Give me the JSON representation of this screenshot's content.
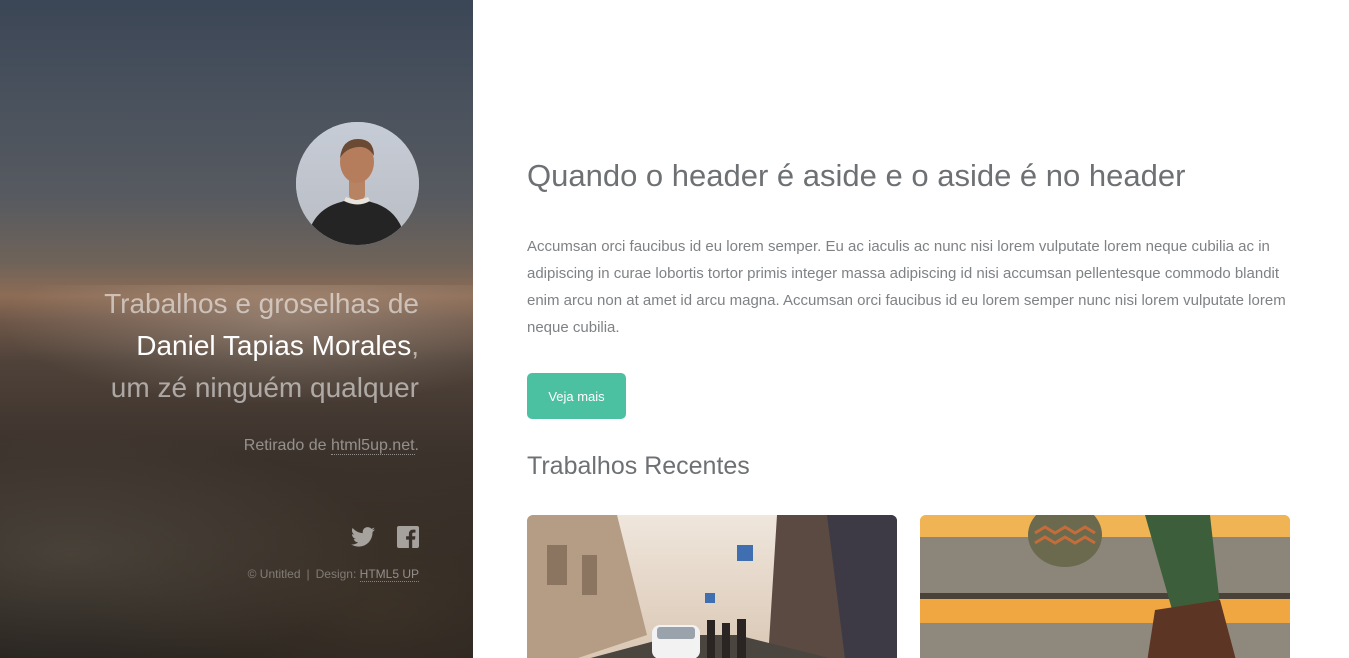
{
  "sidebar": {
    "tagline": {
      "line1": "Trabalhos e groselhas de",
      "name": "Daniel Tapias Morales",
      "comma": ",",
      "line3": "um zé ninguém qualquer"
    },
    "source": {
      "prefix": "Retirado de ",
      "link_text": "html5up.net",
      "suffix": "."
    },
    "social": [
      {
        "icon": "twitter-icon"
      },
      {
        "icon": "facebook-icon"
      }
    ],
    "copyright": {
      "text": "© Untitled",
      "separator": "|",
      "design_label": "Design: ",
      "design_link": "HTML5 UP"
    }
  },
  "main": {
    "title": "Quando o header é aside e o aside é no header",
    "intro": "Accumsan orci faucibus id eu lorem semper. Eu ac iaculis ac nunc nisi lorem vulputate lorem neque cubilia ac in adipiscing in curae lobortis tortor primis integer massa adipiscing id nisi accumsan pellentesque commodo blandit enim arcu non at amet id arcu magna. Accumsan orci faucibus id eu lorem semper nunc nisi lorem vulputate lorem neque cubilia.",
    "button_label": "Veja mais",
    "recent_title": "Trabalhos Recentes"
  },
  "colors": {
    "accent": "#4cc1a1",
    "heading": "#6e7174",
    "body_text": "#7f8285"
  }
}
